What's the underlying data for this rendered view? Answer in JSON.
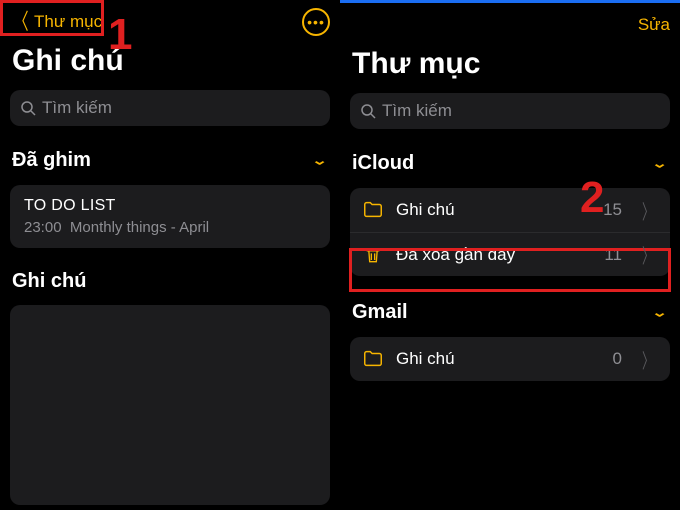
{
  "left": {
    "back_label": "Thư mục",
    "page_title": "Ghi chú",
    "search_placeholder": "Tìm kiếm",
    "pinned_section": "Đã ghim",
    "notes_section": "Ghi chú",
    "note": {
      "title": "TO DO LIST",
      "time": "23:00",
      "preview": "Monthly things - April"
    }
  },
  "right": {
    "edit_label": "Sửa",
    "page_title": "Thư mục",
    "search_placeholder": "Tìm kiếm",
    "accounts": [
      {
        "name": "iCloud",
        "folders": [
          {
            "icon": "folder",
            "label": "Ghi chú",
            "count": 15
          },
          {
            "icon": "trash",
            "label": "Đã xoá gần đây",
            "count": 11
          }
        ]
      },
      {
        "name": "Gmail",
        "folders": [
          {
            "icon": "folder",
            "label": "Ghi chú",
            "count": 0
          }
        ]
      }
    ]
  },
  "annotations": {
    "n1": "1",
    "n2": "2"
  }
}
